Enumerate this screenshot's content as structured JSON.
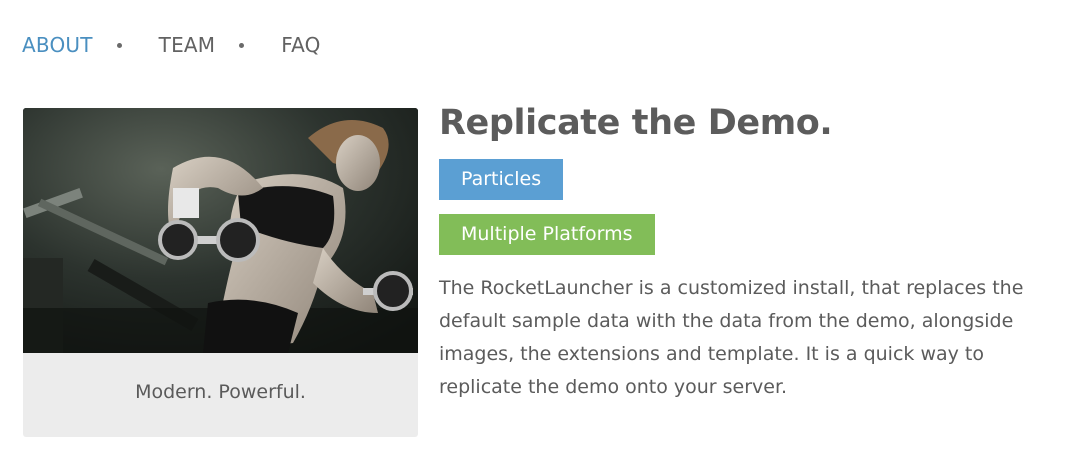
{
  "nav": {
    "tabs": [
      {
        "label": "ABOUT",
        "active": true
      },
      {
        "label": "TEAM",
        "active": false
      },
      {
        "label": "FAQ",
        "active": false
      }
    ]
  },
  "card": {
    "caption": "Modern. Powerful."
  },
  "main": {
    "title": "Replicate the Demo.",
    "badges": [
      "Particles",
      "Multiple Platforms"
    ],
    "description": "The RocketLauncher is a customized install, that replaces the default sample data with the data from the demo, alongside images, the extensions and template. It is a quick way to replicate the demo onto your server."
  },
  "colors": {
    "accent": "#4a8fc0",
    "badge_blue": "#5b9fd3",
    "badge_green": "#82bd58",
    "card_bg": "#ececec"
  }
}
